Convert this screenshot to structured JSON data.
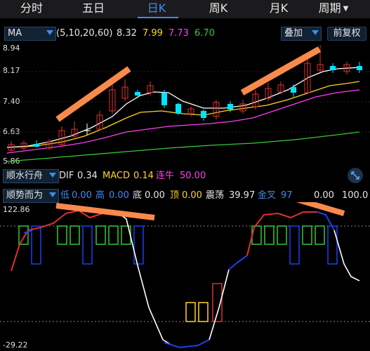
{
  "tabs": [
    {
      "label": "分时",
      "active": false
    },
    {
      "label": "五日",
      "active": false
    },
    {
      "label": "日K",
      "active": true
    },
    {
      "label": "周K",
      "active": false
    },
    {
      "label": "月K",
      "active": false
    },
    {
      "label": "周期",
      "active": false
    }
  ],
  "ma_bar": {
    "indicator": "MA",
    "params": "(5,10,20,60)",
    "v1": "8.32",
    "v2": "7.99",
    "v3": "7.73",
    "v4": "6.70",
    "overlay_btn": "叠加",
    "adjust_btn": "前复权",
    "colors": {
      "v1": "#e6e6e6",
      "v2": "#ffd51f",
      "v3": "#ff3df0",
      "v4": "#37c837"
    }
  },
  "price_axis": [
    "8.94",
    "8.17",
    "7.40",
    "6.63",
    "5.86"
  ],
  "macd_bar": {
    "indicator": "顺水行舟",
    "dif_label": "DIF",
    "dif_value": "0.34",
    "macd_label": "MACD",
    "macd_value": "0.14",
    "lianniu_label": "连牛",
    "lianniu_value": "50.00"
  },
  "osc_bar": {
    "indicator": "顺势而为",
    "low_label": "低",
    "low_value": "0.00",
    "high_label": "高",
    "high_value": "0.00",
    "bottom_label": "底",
    "bottom_value": "0.00",
    "top_label": "顶",
    "top_value": "0.00",
    "shake_label": "震荡",
    "shake_value": "39.97",
    "x_label": "金叉",
    "x_value": "97",
    "y_value": "0.00",
    "z_value": "100.0"
  },
  "osc_axis": {
    "top": "122.86",
    "bottom": "-29.22"
  }
}
